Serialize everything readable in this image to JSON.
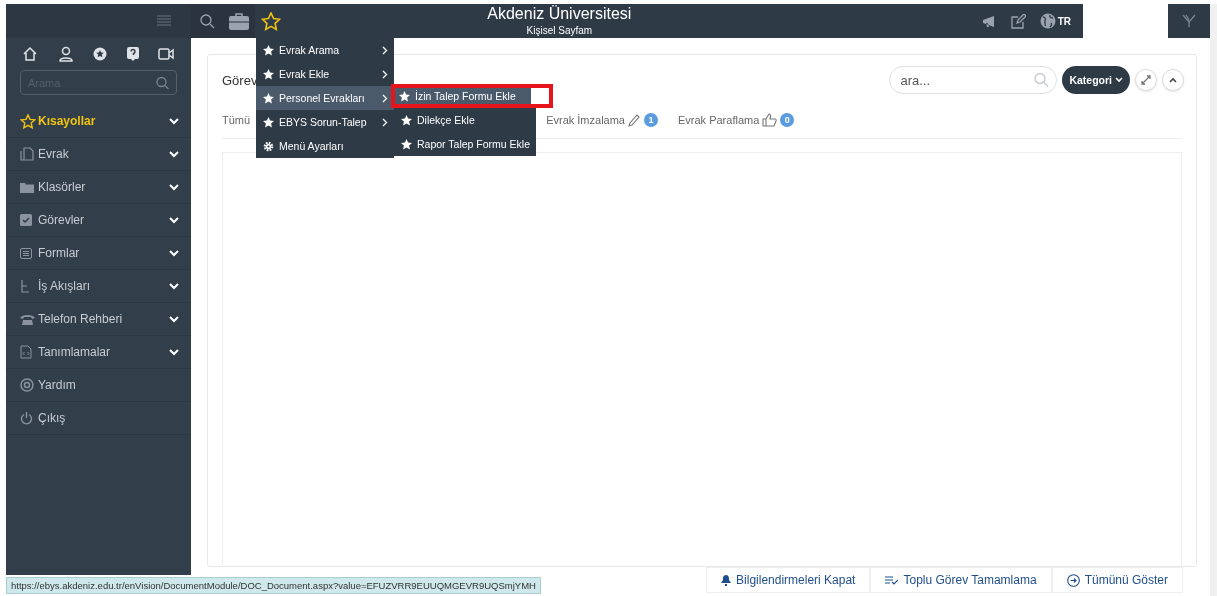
{
  "sidebar": {
    "search": {
      "placeholder": "Arama"
    },
    "items": [
      {
        "label": "Kısayollar",
        "kind": "shortcut",
        "expandable": true
      },
      {
        "label": "Evrak",
        "kind": "normal",
        "expandable": true
      },
      {
        "label": "Klasörler",
        "kind": "normal",
        "expandable": true
      },
      {
        "label": "Görevler",
        "kind": "normal",
        "expandable": true
      },
      {
        "label": "Formlar",
        "kind": "normal",
        "expandable": true
      },
      {
        "label": "İş Akışları",
        "kind": "normal",
        "expandable": true
      },
      {
        "label": "Telefon Rehberi",
        "kind": "normal",
        "expandable": true
      },
      {
        "label": "Tanımlamalar",
        "kind": "normal",
        "expandable": true
      },
      {
        "label": "Yardım",
        "kind": "normal",
        "expandable": false
      },
      {
        "label": "Çıkış",
        "kind": "normal",
        "expandable": false
      }
    ]
  },
  "header": {
    "title": "Akdeniz Üniversitesi",
    "subtitle": "Kişisel Sayfam",
    "language": "TR"
  },
  "menu": {
    "items": [
      {
        "label": "Evrak Arama",
        "submenu": true,
        "selected": false
      },
      {
        "label": "Evrak Ekle",
        "submenu": true,
        "selected": false
      },
      {
        "label": "Personel Evrakları",
        "submenu": true,
        "selected": true
      },
      {
        "label": "EBYS Sorun-Talep",
        "submenu": true,
        "selected": false
      },
      {
        "label": "Menü Ayarları",
        "submenu": false,
        "selected": false
      }
    ],
    "submenu": [
      {
        "label": "İzin Talep Formu Ekle",
        "selected": true,
        "outlined": true
      },
      {
        "label": "Dilekçe Ekle",
        "selected": false,
        "outlined": false
      },
      {
        "label": "Rapor Talep Formu Ekle",
        "selected": false,
        "outlined": false
      }
    ]
  },
  "panel": {
    "title": "Görev",
    "search": {
      "placeholder": "ara..."
    },
    "category_button": "Kategori",
    "tabs": [
      {
        "label": "Tümü"
      },
      {
        "label": "Evrak İmzalama",
        "count": "1"
      },
      {
        "label": "Evrak Paraflama",
        "count": "0"
      }
    ]
  },
  "footer_buttons": [
    "Bilgilendirmeleri Kapat",
    "Toplu Görev Tamamlama",
    "Tümünü Göster"
  ],
  "status_url": "https://ebys.akdeniz.edu.tr/enVision/DocumentModule/DOC_Document.aspx?value=EFUZVRR9EUUQMGEVR9UQSmjYMH"
}
